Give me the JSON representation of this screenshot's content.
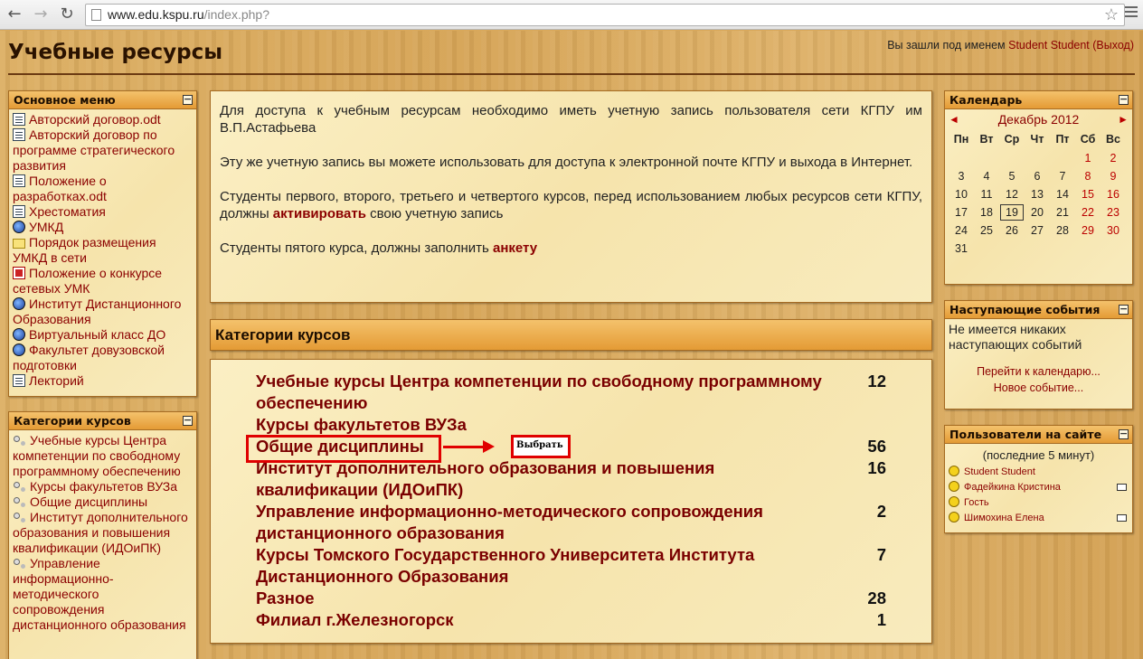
{
  "browser": {
    "url_host": "www.edu.kspu.ru",
    "url_path": "/index.php?"
  },
  "header": {
    "site_title": "Учебные ресурсы",
    "login_prefix": "Вы зашли под именем ",
    "user_name": "Student Student",
    "logout_open": " (",
    "logout_label": "Выход",
    "logout_close": ")"
  },
  "main_menu": {
    "title": "Основное меню",
    "items": [
      {
        "icon": "document-icon",
        "label": "Авторский договор.odt"
      },
      {
        "icon": "document-icon",
        "label": "Авторский договор по программе стратегического развития"
      },
      {
        "icon": "document-icon",
        "label": "Положение о разработках.odt"
      },
      {
        "icon": "document-icon",
        "label": "Хрестоматия"
      },
      {
        "icon": "web-icon",
        "label": "УМКД"
      },
      {
        "icon": "folder-icon",
        "label": "Порядок размещения УМКД в сети"
      },
      {
        "icon": "pdf-icon",
        "label": "Положение о конкурсе сетевых УМК"
      },
      {
        "icon": "web-icon",
        "label": "Институт Дистанционного Образования"
      },
      {
        "icon": "web-icon",
        "label": "Виртуальный класс ДО"
      },
      {
        "icon": "web-icon",
        "label": "Факультет довузовской подготовки"
      },
      {
        "icon": "document-icon",
        "label": "Лекторий"
      }
    ]
  },
  "side_categories": {
    "title": "Категории курсов",
    "items": [
      "Учебные курсы Центра компетенции по свободному программному обеспечению",
      "Курсы факультетов ВУЗа",
      "Общие дисциплины",
      "Институт дополнительного образования и повышения квалификации (ИДОиПК)",
      "Управление информационно-методического сопровождения дистанционного образования"
    ]
  },
  "intro": {
    "p1": "Для доступа к учебным ресурсам необходимо иметь учетную запись пользователя сети КГПУ им В.П.Астафьева",
    "p2": "Эту же учетную запись вы можете использовать для доступа к электронной почте КГПУ и выхода в Интернет.",
    "p3_before": "Студенты первого, второго, третьего и четвертого курсов, перед использованием любых ресурсов сети КГПУ, должны ",
    "p3_link": "активировать",
    "p3_after": " свою учетную запись",
    "p4_before": "Студенты пятого курса, должны заполнить ",
    "p4_link": "анкету"
  },
  "categories": {
    "title": "Категории курсов",
    "items": [
      {
        "name": "Учебные курсы Центра компетенции по свободному программному обеспечению",
        "count": "12"
      },
      {
        "name": "Курсы факультетов ВУЗа",
        "count": ""
      },
      {
        "name": "Общие дисциплины",
        "count": "56"
      },
      {
        "name": "Институт дополнительного образования и повышения квалификации (ИДОиПК)",
        "count": "16"
      },
      {
        "name": "Управление информационно-методического сопровождения дистанционного образования",
        "count": "2"
      },
      {
        "name": "Курсы Томского Государственного Университета Института Дистанционного Образования",
        "count": "7"
      },
      {
        "name": "Разное",
        "count": "28"
      },
      {
        "name": "Филиал г.Железногорск",
        "count": "1"
      }
    ]
  },
  "annotation": {
    "callout_text": "Выбрать",
    "color": "#e00000"
  },
  "calendar": {
    "title": "Календарь",
    "month": "Декабрь 2012",
    "prev": "◄",
    "next": "►",
    "weekdays": [
      "Пн",
      "Вт",
      "Ср",
      "Чт",
      "Пт",
      "Сб",
      "Вс"
    ],
    "weeks": [
      [
        "",
        "",
        "",
        "",
        "",
        "1",
        "2"
      ],
      [
        "3",
        "4",
        "5",
        "6",
        "7",
        "8",
        "9"
      ],
      [
        "10",
        "11",
        "12",
        "13",
        "14",
        "15",
        "16"
      ],
      [
        "17",
        "18",
        "19",
        "20",
        "21",
        "22",
        "23"
      ],
      [
        "24",
        "25",
        "26",
        "27",
        "28",
        "29",
        "30"
      ],
      [
        "31",
        "",
        "",
        "",
        "",
        "",
        ""
      ]
    ],
    "today": "19"
  },
  "events": {
    "title": "Наступающие события",
    "empty_text": "Не имеется никаких наступающих событий",
    "goto_calendar": "Перейти к календарю...",
    "new_event": "Новое событие..."
  },
  "online_users": {
    "title": "Пользователи на сайте",
    "subtitle": "(последние 5 минут)",
    "users": [
      {
        "name": "Student Student",
        "mail": false
      },
      {
        "name": "Фадейкина Кристина",
        "mail": true
      },
      {
        "name": "Гость",
        "mail": false
      },
      {
        "name": "Шимохина Елена",
        "mail": true
      }
    ]
  },
  "colors": {
    "link": "#8b0000",
    "header_bar": "#e49b35",
    "block_bg": "#f6e4ac",
    "page_bg": "#d9a85a"
  }
}
